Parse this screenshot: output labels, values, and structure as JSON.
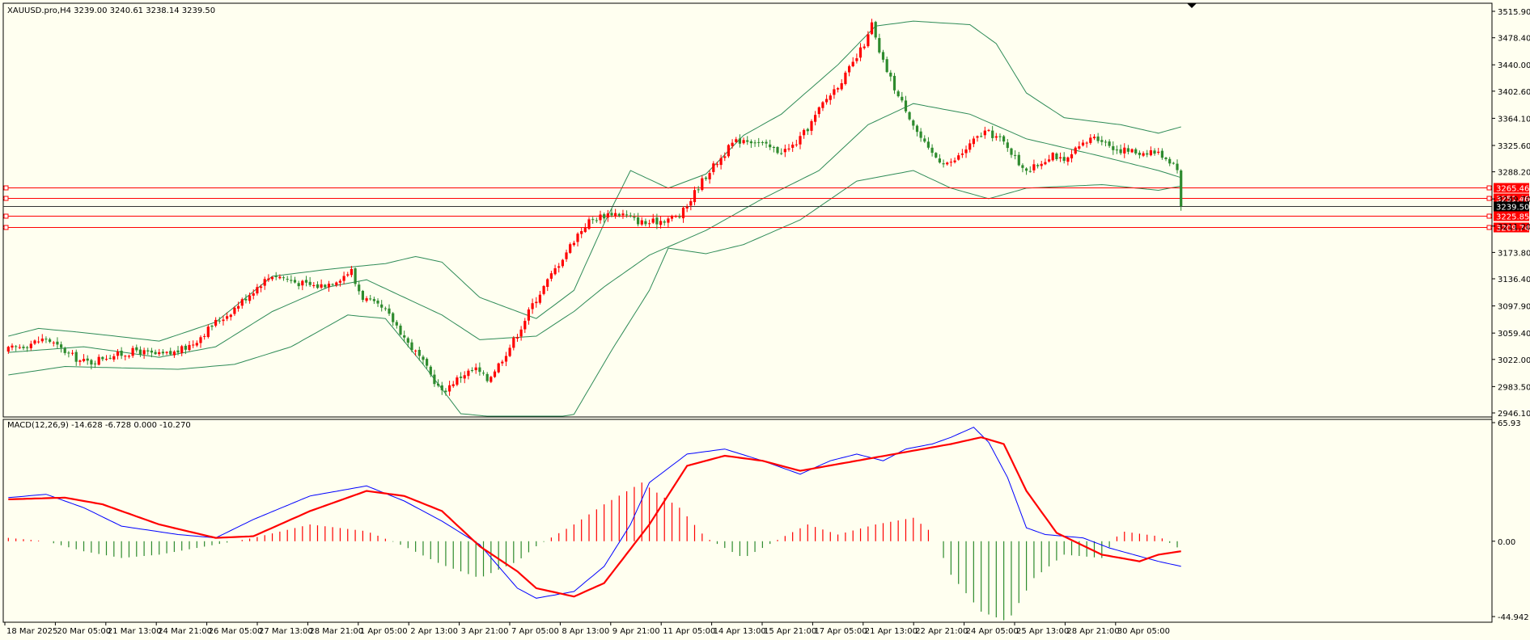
{
  "window": {
    "symbol_line": "XAUUSD.pro,H4  3239.00 3240.61 3238.14 3239.50"
  },
  "macd_header": "MACD(12,26,9) -14.628 -6.728 0.000 -10.270",
  "colors": {
    "background": "#fffff0",
    "bull": "#ff0000",
    "bear": "#2e8b2e",
    "bands": "#2e8b57",
    "macd_main": "#0000ff",
    "macd_signal": "#ff0000",
    "level_line": "#ff0000",
    "price_tag": "#000000"
  },
  "chart_data": [
    {
      "type": "candlestick",
      "title": "XAUUSD.pro,H4",
      "ylim": [
        2946.1,
        3515.9
      ],
      "price_ticks": [
        "3515.90",
        "3478.40",
        "3440.00",
        "3402.60",
        "3364.10",
        "3325.60",
        "3288.20",
        "3249.70",
        "3211.20",
        "3173.80",
        "3136.40",
        "3097.90",
        "3059.40",
        "3022.00",
        "2983.50",
        "2946.10"
      ],
      "x_labels": [
        "18 Mar 2025",
        "20 Mar 05:00",
        "21 Mar 13:00",
        "24 Mar 21:00",
        "26 Mar 05:00",
        "27 Mar 13:00",
        "28 Mar 21:00",
        "1 Apr 05:00",
        "2 Apr 13:00",
        "3 Apr 21:00",
        "7 Apr 05:00",
        "8 Apr 13:00",
        "9 Apr 21:00",
        "11 Apr 05:00",
        "14 Apr 13:00",
        "15 Apr 21:00",
        "17 Apr 05:00",
        "21 Apr 13:00",
        "22 Apr 21:00",
        "24 Apr 05:00",
        "25 Apr 13:00",
        "28 Apr 21:00",
        "30 Apr 05:00"
      ],
      "levels": [
        {
          "price": 3265.46,
          "label": "3265.46"
        },
        {
          "price": 3251.46,
          "label": "3251.46"
        },
        {
          "price": 3225.85,
          "label": "3225.85"
        },
        {
          "price": 3209.74,
          "label": "3209.74"
        }
      ],
      "current_price": {
        "price": 3239.5,
        "label": "3239.50"
      },
      "close_path": [
        [
          0,
          3036
        ],
        [
          6,
          3045
        ],
        [
          10,
          3052
        ],
        [
          13,
          3040
        ],
        [
          16,
          3030
        ],
        [
          19,
          3020
        ],
        [
          22,
          3018
        ],
        [
          25,
          3025
        ],
        [
          28,
          3028
        ],
        [
          31,
          3030
        ],
        [
          34,
          3035
        ],
        [
          37,
          3030
        ],
        [
          40,
          3028
        ],
        [
          43,
          3030
        ],
        [
          46,
          3036
        ],
        [
          49,
          3045
        ],
        [
          52,
          3060
        ],
        [
          55,
          3075
        ],
        [
          58,
          3085
        ],
        [
          61,
          3100
        ],
        [
          64,
          3115
        ],
        [
          67,
          3130
        ],
        [
          70,
          3142
        ],
        [
          73,
          3138
        ],
        [
          76,
          3132
        ],
        [
          79,
          3128
        ],
        [
          82,
          3126
        ],
        [
          85,
          3130
        ],
        [
          88,
          3138
        ],
        [
          91,
          3148
        ],
        [
          92,
          3130
        ],
        [
          94,
          3110
        ],
        [
          97,
          3100
        ],
        [
          100,
          3090
        ],
        [
          103,
          3070
        ],
        [
          106,
          3045
        ],
        [
          109,
          3025
        ],
        [
          112,
          3000
        ],
        [
          115,
          2975
        ],
        [
          118,
          2990
        ],
        [
          121,
          3002
        ],
        [
          124,
          3008
        ],
        [
          127,
          2993
        ],
        [
          130,
          3015
        ],
        [
          133,
          3040
        ],
        [
          136,
          3068
        ],
        [
          139,
          3100
        ],
        [
          142,
          3125
        ],
        [
          145,
          3150
        ],
        [
          148,
          3175
        ],
        [
          151,
          3200
        ],
        [
          154,
          3218
        ],
        [
          157,
          3225
        ],
        [
          160,
          3230
        ],
        [
          163,
          3228
        ],
        [
          166,
          3220
        ],
        [
          169,
          3215
        ],
        [
          172,
          3218
        ],
        [
          175,
          3222
        ],
        [
          178,
          3225
        ],
        [
          180,
          3240
        ],
        [
          183,
          3268
        ],
        [
          186,
          3290
        ],
        [
          189,
          3308
        ],
        [
          192,
          3328
        ],
        [
          195,
          3335
        ],
        [
          198,
          3332
        ],
        [
          201,
          3324
        ],
        [
          204,
          3318
        ],
        [
          207,
          3320
        ],
        [
          210,
          3335
        ],
        [
          213,
          3358
        ],
        [
          216,
          3385
        ],
        [
          219,
          3405
        ],
        [
          222,
          3425
        ],
        [
          225,
          3450
        ],
        [
          228,
          3480
        ],
        [
          229,
          3498
        ],
        [
          231,
          3455
        ],
        [
          234,
          3420
        ],
        [
          236,
          3395
        ],
        [
          238,
          3378
        ],
        [
          241,
          3345
        ],
        [
          244,
          3318
        ],
        [
          247,
          3305
        ],
        [
          250,
          3300
        ],
        [
          253,
          3315
        ],
        [
          256,
          3332
        ],
        [
          259,
          3345
        ],
        [
          262,
          3338
        ],
        [
          265,
          3325
        ],
        [
          268,
          3300
        ],
        [
          271,
          3290
        ],
        [
          274,
          3302
        ],
        [
          277,
          3315
        ],
        [
          280,
          3300
        ],
        [
          283,
          3318
        ],
        [
          286,
          3330
        ],
        [
          288,
          3340
        ],
        [
          291,
          3330
        ],
        [
          294,
          3320
        ],
        [
          297,
          3318
        ],
        [
          300,
          3315
        ],
        [
          303,
          3318
        ],
        [
          306,
          3312
        ],
        [
          309,
          3300
        ],
        [
          310,
          3295
        ],
        [
          311,
          3239.5
        ]
      ],
      "bb_upper": [
        [
          0,
          3055
        ],
        [
          8,
          3066
        ],
        [
          20,
          3060
        ],
        [
          40,
          3048
        ],
        [
          55,
          3075
        ],
        [
          70,
          3140
        ],
        [
          85,
          3150
        ],
        [
          100,
          3158
        ],
        [
          108,
          3168
        ],
        [
          115,
          3160
        ],
        [
          125,
          3110
        ],
        [
          140,
          3080
        ],
        [
          150,
          3120
        ],
        [
          158,
          3215
        ],
        [
          165,
          3290
        ],
        [
          175,
          3265
        ],
        [
          185,
          3285
        ],
        [
          195,
          3340
        ],
        [
          205,
          3370
        ],
        [
          220,
          3440
        ],
        [
          230,
          3495
        ],
        [
          240,
          3502
        ],
        [
          255,
          3497
        ],
        [
          262,
          3470
        ],
        [
          270,
          3400
        ],
        [
          280,
          3365
        ],
        [
          295,
          3355
        ],
        [
          305,
          3343
        ],
        [
          311,
          3352
        ]
      ],
      "bb_middle": [
        [
          0,
          3032
        ],
        [
          20,
          3040
        ],
        [
          40,
          3025
        ],
        [
          55,
          3040
        ],
        [
          70,
          3090
        ],
        [
          85,
          3125
        ],
        [
          95,
          3135
        ],
        [
          105,
          3110
        ],
        [
          115,
          3085
        ],
        [
          125,
          3050
        ],
        [
          140,
          3055
        ],
        [
          150,
          3090
        ],
        [
          158,
          3125
        ],
        [
          170,
          3170
        ],
        [
          185,
          3205
        ],
        [
          200,
          3250
        ],
        [
          215,
          3290
        ],
        [
          228,
          3355
        ],
        [
          240,
          3385
        ],
        [
          255,
          3370
        ],
        [
          270,
          3335
        ],
        [
          290,
          3310
        ],
        [
          305,
          3290
        ],
        [
          311,
          3280
        ]
      ],
      "bb_lower": [
        [
          0,
          3000
        ],
        [
          15,
          3012
        ],
        [
          30,
          3010
        ],
        [
          45,
          3008
        ],
        [
          60,
          3015
        ],
        [
          75,
          3040
        ],
        [
          90,
          3085
        ],
        [
          100,
          3080
        ],
        [
          110,
          3015
        ],
        [
          120,
          2945
        ],
        [
          130,
          2940
        ],
        [
          140,
          2935
        ],
        [
          150,
          2944
        ],
        [
          160,
          3035
        ],
        [
          170,
          3120
        ],
        [
          175,
          3180
        ],
        [
          185,
          3172
        ],
        [
          195,
          3185
        ],
        [
          210,
          3220
        ],
        [
          225,
          3275
        ],
        [
          240,
          3290
        ],
        [
          250,
          3265
        ],
        [
          260,
          3250
        ],
        [
          270,
          3265
        ],
        [
          290,
          3270
        ],
        [
          305,
          3262
        ],
        [
          311,
          3268
        ]
      ]
    },
    {
      "type": "macd",
      "title": "MACD(12,26,9)",
      "ylim": [
        -44.942,
        65.93
      ],
      "scale_ticks": [
        "65.93",
        "0.00",
        "-44.942"
      ],
      "main": [
        [
          0,
          26
        ],
        [
          10,
          28
        ],
        [
          20,
          20
        ],
        [
          30,
          9
        ],
        [
          45,
          4
        ],
        [
          55,
          2
        ],
        [
          65,
          13
        ],
        [
          80,
          27
        ],
        [
          95,
          33
        ],
        [
          105,
          24
        ],
        [
          115,
          12
        ],
        [
          125,
          -2
        ],
        [
          135,
          -28
        ],
        [
          140,
          -34
        ],
        [
          150,
          -30
        ],
        [
          158,
          -15
        ],
        [
          165,
          10
        ],
        [
          170,
          35
        ],
        [
          180,
          52
        ],
        [
          190,
          55
        ],
        [
          200,
          48
        ],
        [
          210,
          40
        ],
        [
          218,
          48
        ],
        [
          225,
          52
        ],
        [
          232,
          48
        ],
        [
          238,
          55
        ],
        [
          245,
          58
        ],
        [
          250,
          62
        ],
        [
          256,
          68
        ],
        [
          260,
          59
        ],
        [
          265,
          38
        ],
        [
          270,
          8
        ],
        [
          275,
          4
        ],
        [
          285,
          2
        ],
        [
          292,
          -4
        ],
        [
          300,
          -9
        ],
        [
          305,
          -12
        ],
        [
          311,
          -15
        ]
      ],
      "signal": [
        [
          0,
          25
        ],
        [
          15,
          26
        ],
        [
          25,
          22
        ],
        [
          40,
          10
        ],
        [
          55,
          2
        ],
        [
          65,
          3
        ],
        [
          80,
          18
        ],
        [
          95,
          30
        ],
        [
          105,
          27
        ],
        [
          115,
          18
        ],
        [
          125,
          -3
        ],
        [
          135,
          -18
        ],
        [
          140,
          -28
        ],
        [
          150,
          -33
        ],
        [
          158,
          -25
        ],
        [
          170,
          10
        ],
        [
          180,
          45
        ],
        [
          190,
          51
        ],
        [
          200,
          48
        ],
        [
          210,
          42
        ],
        [
          220,
          46
        ],
        [
          230,
          50
        ],
        [
          240,
          54
        ],
        [
          250,
          58
        ],
        [
          258,
          62
        ],
        [
          264,
          58
        ],
        [
          270,
          30
        ],
        [
          278,
          5
        ],
        [
          290,
          -8
        ],
        [
          300,
          -12
        ],
        [
          305,
          -8
        ],
        [
          311,
          -6
        ]
      ],
      "histogram": [
        [
          0,
          2
        ],
        [
          10,
          0
        ],
        [
          20,
          -6
        ],
        [
          30,
          -10
        ],
        [
          40,
          -8
        ],
        [
          55,
          -2
        ],
        [
          65,
          2
        ],
        [
          80,
          10
        ],
        [
          95,
          6
        ],
        [
          105,
          -3
        ],
        [
          115,
          -14
        ],
        [
          125,
          -22
        ],
        [
          135,
          -12
        ],
        [
          140,
          -3
        ],
        [
          150,
          10
        ],
        [
          158,
          22
        ],
        [
          168,
          35
        ],
        [
          178,
          20
        ],
        [
          185,
          2
        ],
        [
          195,
          -10
        ],
        [
          205,
          2
        ],
        [
          212,
          10
        ],
        [
          220,
          4
        ],
        [
          230,
          10
        ],
        [
          240,
          14
        ],
        [
          245,
          5
        ],
        [
          250,
          -20
        ],
        [
          258,
          -42
        ],
        [
          265,
          -48
        ],
        [
          272,
          -22
        ],
        [
          280,
          -8
        ],
        [
          290,
          -10
        ],
        [
          295,
          6
        ],
        [
          305,
          3
        ],
        [
          311,
          -5
        ]
      ]
    }
  ]
}
